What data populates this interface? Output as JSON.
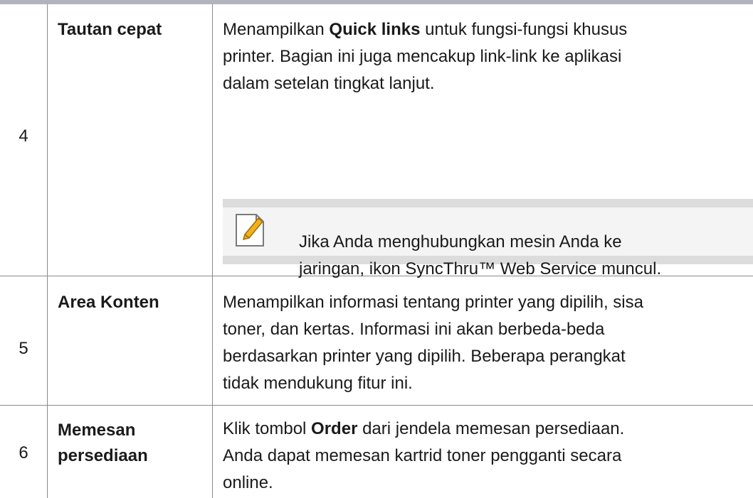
{
  "rows": [
    {
      "number": "4",
      "term": "Tautan cepat",
      "desc_lines": [
        [
          "Menampilkan ",
          "Quick links",
          " untuk fungsi-fungsi khusus"
        ],
        "printer. Bagian ini juga mencakup link-link ke aplikasi",
        "dalam setelan tingkat lanjut."
      ],
      "note": {
        "icon": "note-pencil-icon",
        "lines": [
          "Jika Anda menghubungkan mesin Anda ke",
          "jaringan, ikon SyncThru™ Web Service muncul."
        ]
      }
    },
    {
      "number": "5",
      "term": "Area Konten",
      "desc_lines": [
        "Menampilkan informasi tentang printer yang dipilih, sisa",
        "toner, dan kertas. Informasi ini akan berbeda-beda",
        "berdasarkan printer yang dipilih. Beberapa perangkat",
        "tidak mendukung fitur ini."
      ]
    },
    {
      "number": "6",
      "term_lines": [
        "Memesan",
        "persediaan"
      ],
      "desc_lines": [
        [
          "Klik tombol ",
          "Order",
          " dari jendela memesan persediaan."
        ],
        "Anda dapat memesan kartrid toner pengganti secara",
        "online."
      ]
    }
  ]
}
